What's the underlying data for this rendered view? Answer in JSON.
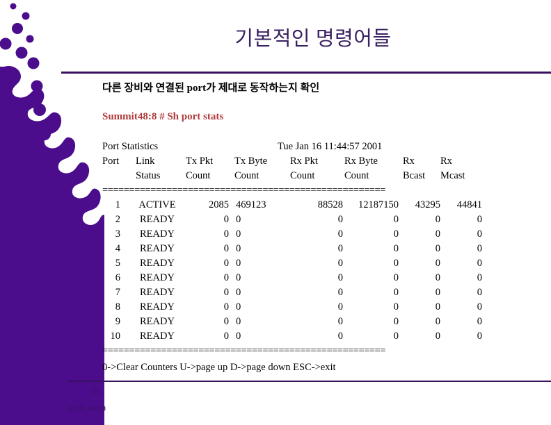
{
  "slide": {
    "title": "기본적인 명령어들",
    "subtitle": "다른 장비와 연결된 port가 제대로 동작하는지 확인",
    "command": "Summit48:8 # Sh port stats",
    "page_number": "21",
    "date": "2020-10-29",
    "accent_color": "#3a1060",
    "title_color": "#3a2060",
    "command_color": "#b03a3a",
    "deco_color": "#4b0d8c"
  },
  "console": {
    "report_title": "Port Statistics",
    "timestamp": "Tue Jan 16 11:44:57 2001",
    "separator": "=====================================================",
    "headers_line1": [
      "Port",
      "Link",
      "Tx Pkt",
      "Tx Byte",
      "Rx Pkt",
      "Rx Byte",
      "Rx",
      "Rx"
    ],
    "headers_line2": [
      "",
      "Status",
      "Count",
      "Count",
      "Count",
      "Count",
      "Bcast",
      "Mcast"
    ],
    "rows": [
      {
        "port": "1",
        "link": "ACTIVE",
        "tx_pkt": "2085",
        "tx_byte": "469123",
        "rx_pkt": "88528",
        "rx_byte": "12187150",
        "rx_bcast": "43295",
        "rx_mcast": "44841"
      },
      {
        "port": "2",
        "link": "READY",
        "tx_pkt": "0",
        "tx_byte": "0",
        "rx_pkt": "0",
        "rx_byte": "0",
        "rx_bcast": "0",
        "rx_mcast": "0"
      },
      {
        "port": "3",
        "link": "READY",
        "tx_pkt": "0",
        "tx_byte": "0",
        "rx_pkt": "0",
        "rx_byte": "0",
        "rx_bcast": "0",
        "rx_mcast": "0"
      },
      {
        "port": "4",
        "link": "READY",
        "tx_pkt": "0",
        "tx_byte": "0",
        "rx_pkt": "0",
        "rx_byte": "0",
        "rx_bcast": "0",
        "rx_mcast": "0"
      },
      {
        "port": "5",
        "link": "READY",
        "tx_pkt": "0",
        "tx_byte": "0",
        "rx_pkt": "0",
        "rx_byte": "0",
        "rx_bcast": "0",
        "rx_mcast": "0"
      },
      {
        "port": "6",
        "link": "READY",
        "tx_pkt": "0",
        "tx_byte": "0",
        "rx_pkt": "0",
        "rx_byte": "0",
        "rx_bcast": "0",
        "rx_mcast": "0"
      },
      {
        "port": "7",
        "link": "READY",
        "tx_pkt": "0",
        "tx_byte": "0",
        "rx_pkt": "0",
        "rx_byte": "0",
        "rx_bcast": "0",
        "rx_mcast": "0"
      },
      {
        "port": "8",
        "link": "READY",
        "tx_pkt": "0",
        "tx_byte": "0",
        "rx_pkt": "0",
        "rx_byte": "0",
        "rx_bcast": "0",
        "rx_mcast": "0"
      },
      {
        "port": "9",
        "link": "READY",
        "tx_pkt": "0",
        "tx_byte": "0",
        "rx_pkt": "0",
        "rx_byte": "0",
        "rx_bcast": "0",
        "rx_mcast": "0"
      },
      {
        "port": "10",
        "link": "READY",
        "tx_pkt": "0",
        "tx_byte": "0",
        "rx_pkt": "0",
        "rx_byte": "0",
        "rx_bcast": "0",
        "rx_mcast": "0"
      }
    ],
    "key_hints": "0->Clear Counters  U->page up  D->page down ESC->exit"
  }
}
